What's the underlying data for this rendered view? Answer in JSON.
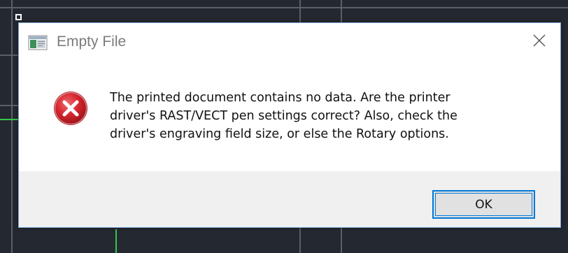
{
  "dialog": {
    "title": "Empty File",
    "app_icon": "app-window-icon",
    "close_icon": "close-icon",
    "error_icon": "error-x-icon",
    "message": "The printed document contains no data.  Are the printer\ndriver's RAST/VECT pen settings correct?  Also, check the\ndriver's engraving field size, or else the Rotary options.",
    "ok_label": "OK"
  },
  "colors": {
    "error_red": "#d6262f",
    "accent_blue": "#0078d7",
    "cad_green": "#34c84a"
  }
}
